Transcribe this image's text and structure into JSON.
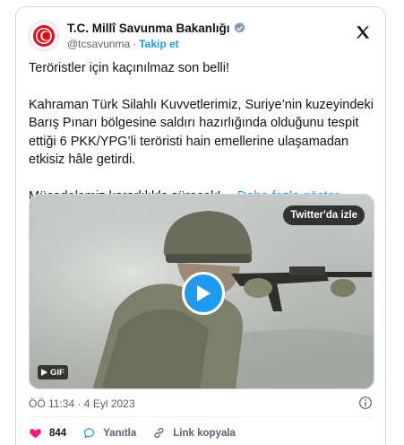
{
  "account": {
    "display_name": "T.C. Millî Savunma Bakanlığı",
    "handle": "@tcsavunma",
    "separator": "·",
    "follow_label": "Takip et"
  },
  "tweet": {
    "line1": "Teröristler için kaçınılmaz son belli!",
    "paragraph2": "Kahraman Türk Silahlı Kuvvetlerimiz, Suriye’nin kuzeyindeki Barış Pınarı bölgesine saldırı hazırlığında olduğunu tespit ettiği 6 PKK/YPG’li teröristi hain emellerine ulaşamadan etkisiz hâle getirdi.",
    "paragraph3": "Mücadelemiz kararlılıkla sürecek!…",
    "show_more": "Daha fazla göster"
  },
  "media": {
    "watch_label": "Twitter'da izle",
    "badge_label": "GIF"
  },
  "meta": {
    "timestamp": "ÖÖ 11:34 · 4 Eyl 2023"
  },
  "actions": {
    "like_count": "844",
    "reply_label": "Yanıtla",
    "copy_link_label": "Link kopyala"
  },
  "colors": {
    "accent": "#1d9bf0",
    "like": "#f91880",
    "muted": "#536471"
  }
}
